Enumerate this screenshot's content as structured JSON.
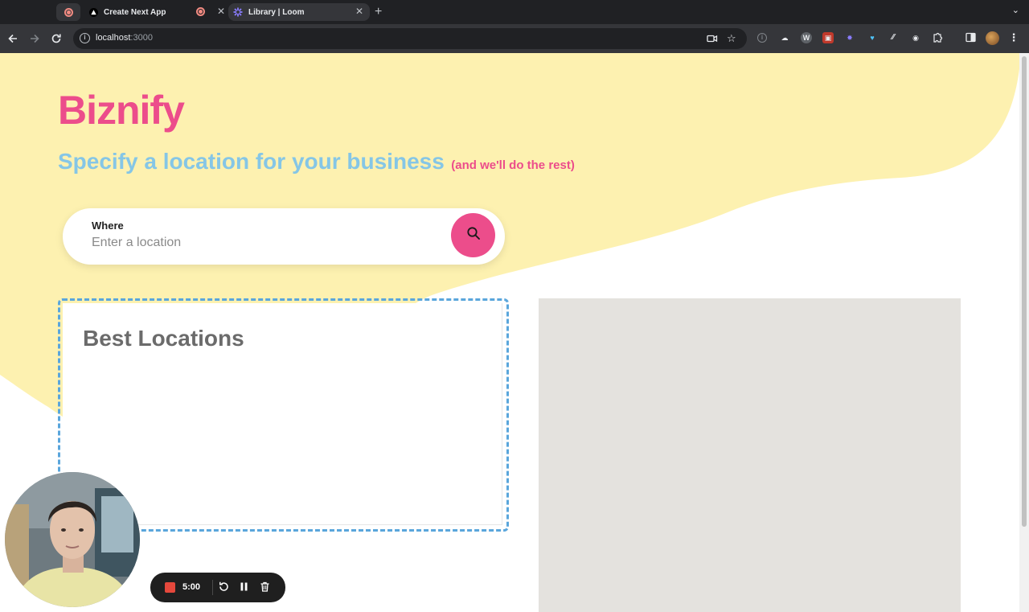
{
  "browser": {
    "tabs": [
      {
        "title": "",
        "type": "recording"
      },
      {
        "title": "Create Next App"
      },
      {
        "title": "Library | Loom"
      }
    ],
    "url_host": "localhost",
    "url_port": ":3000"
  },
  "page": {
    "brand": "Biznify",
    "tagline_main": "Specify a location for your business",
    "tagline_sub": "(and we'll do the rest)",
    "search": {
      "label": "Where",
      "placeholder": "Enter a location",
      "value": ""
    },
    "best_locations_title": "Best Locations"
  },
  "loom": {
    "timer": "5:00"
  },
  "colors": {
    "brand_pink": "#ec4d8b",
    "tagline_blue": "#85c6e6",
    "blob_yellow": "#fdf1b0",
    "panel_border_blue": "#5aa6dc",
    "map_gray": "#e4e2de"
  },
  "icons": [
    "back-arrow-icon",
    "forward-arrow-icon",
    "reload-icon",
    "info-icon",
    "camera-icon",
    "bookmark-star-icon",
    "puzzle-extensions-icon",
    "sidebar-icon",
    "kebab-menu-icon",
    "search-icon",
    "stop-icon",
    "restart-icon",
    "pause-icon",
    "trash-icon"
  ]
}
